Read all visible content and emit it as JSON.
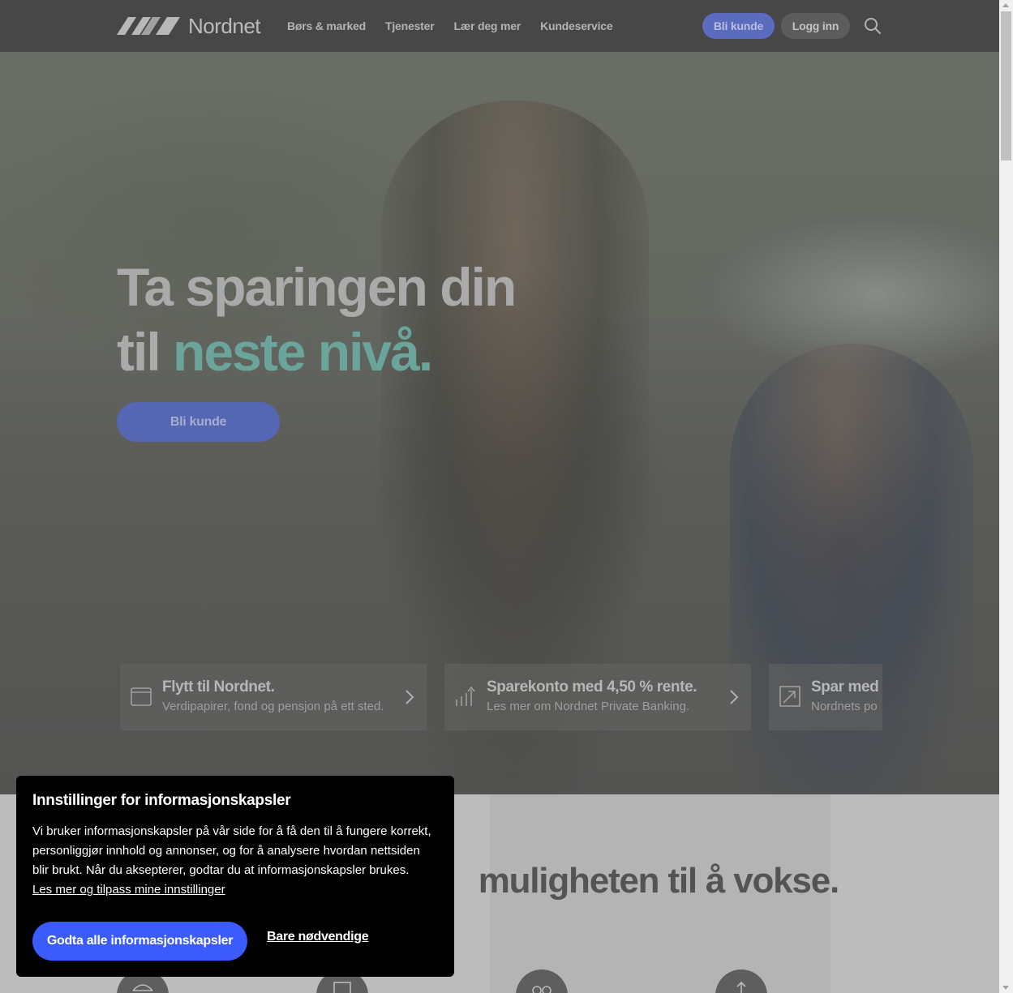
{
  "header": {
    "logo_text": "Nordnet",
    "nav": [
      {
        "label": "Børs & marked"
      },
      {
        "label": "Tjenester"
      },
      {
        "label": "Lær deg mer"
      },
      {
        "label": "Kundeservice"
      }
    ],
    "signup_label": "Bli kunde",
    "login_label": "Logg inn",
    "search_icon": "search-icon"
  },
  "hero": {
    "title_line1": "Ta sparingen din",
    "title_line2_plain": "til ",
    "title_line2_accent": "neste nivå.",
    "cta_label": "Bli kunde",
    "cards": [
      {
        "title": "Flytt til Nordnet.",
        "subtitle": "Verdipapirer, fond og pensjon på ett sted.",
        "icon": "wallet-icon"
      },
      {
        "title": "Sparekonto med 4,50 % rente.",
        "subtitle": "Les mer om Nordnet Private Banking.",
        "icon": "bar-chart-icon"
      },
      {
        "title": "Spar med",
        "subtitle": "Nordnets po",
        "icon": "trend-arrow-icon"
      }
    ]
  },
  "lower": {
    "heading": "muligheten til å vokse."
  },
  "cookie": {
    "title": "Innstillinger for informasjonskapsler",
    "text": "Vi bruker informasjonskapsler på vår side for å få den til å fungere korrekt, personliggjør innhold og annonser, og for å analysere hvordan nettsiden blir brukt. Når du aksepterer, godtar du at informasjonskapsler brukes.",
    "link": "Les mer og tilpass mine innstillinger",
    "accept_label": "Godta alle informasjonskapsler",
    "necessary_label": "Bare nødvendige"
  },
  "colors": {
    "accent_green": "#6aa49a",
    "brand_blue": "#3b5bfd",
    "header_bg": "#474747"
  }
}
